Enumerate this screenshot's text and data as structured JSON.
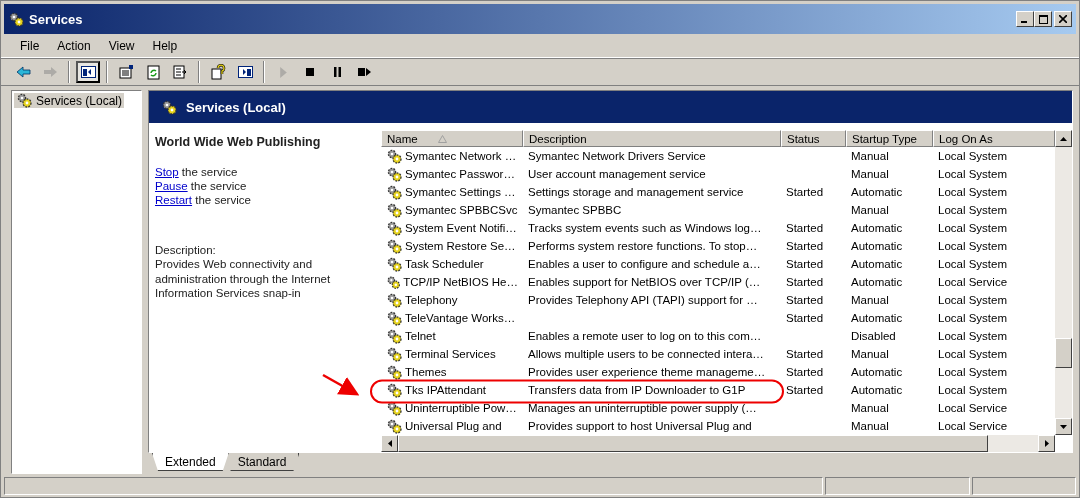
{
  "window": {
    "title": "Services"
  },
  "menu": [
    {
      "label": "File"
    },
    {
      "label": "Action"
    },
    {
      "label": "View"
    },
    {
      "label": "Help"
    }
  ],
  "toolbar": [
    {
      "kind": "back",
      "disabled": false,
      "pressed": false
    },
    {
      "kind": "forward",
      "disabled": true,
      "pressed": false
    },
    {
      "kind": "separator"
    },
    {
      "kind": "tree",
      "disabled": false,
      "pressed": true
    },
    {
      "kind": "separator"
    },
    {
      "kind": "properties",
      "disabled": false,
      "pressed": false
    },
    {
      "kind": "refresh",
      "disabled": false,
      "pressed": false
    },
    {
      "kind": "export",
      "disabled": false,
      "pressed": false
    },
    {
      "kind": "separator"
    },
    {
      "kind": "help",
      "disabled": false,
      "pressed": false
    },
    {
      "kind": "console",
      "disabled": false,
      "pressed": false
    },
    {
      "kind": "separator"
    },
    {
      "kind": "start",
      "disabled": true,
      "pressed": false
    },
    {
      "kind": "stop",
      "disabled": false,
      "pressed": false
    },
    {
      "kind": "pause",
      "disabled": false,
      "pressed": false
    },
    {
      "kind": "restart",
      "disabled": false,
      "pressed": false
    }
  ],
  "tree": [
    {
      "label": "Services (Local)",
      "selected": true
    }
  ],
  "header": {
    "title": "Services (Local)"
  },
  "details": {
    "title": "World Wide Web Publishing",
    "actions": [
      {
        "link": "Stop",
        "text": " the service"
      },
      {
        "link": "Pause",
        "text": " the service"
      },
      {
        "link": "Restart",
        "text": " the service"
      }
    ],
    "description_label": "Description:",
    "description": "Provides Web connectivity and administration through the Internet Information Services snap-in"
  },
  "table": {
    "columns": [
      {
        "label": "Name",
        "sorted": true
      },
      {
        "label": "Description",
        "sorted": false
      },
      {
        "label": "Status",
        "sorted": false
      },
      {
        "label": "Startup Type",
        "sorted": false
      },
      {
        "label": "Log On As",
        "sorted": false
      }
    ],
    "rows": [
      [
        "Symantec Network …",
        "Symantec Network Drivers Service",
        "",
        "Manual",
        "Local System"
      ],
      [
        "Symantec Passwor…",
        "User account management service",
        "",
        "Manual",
        "Local System"
      ],
      [
        "Symantec Settings …",
        "Settings storage and management service",
        "Started",
        "Automatic",
        "Local System"
      ],
      [
        "Symantec SPBBCSvc",
        "Symantec SPBBC",
        "",
        "Manual",
        "Local System"
      ],
      [
        "System Event Notifi…",
        "Tracks system events such as Windows log…",
        "Started",
        "Automatic",
        "Local System"
      ],
      [
        "System Restore Se…",
        "Performs system restore functions. To stop…",
        "Started",
        "Automatic",
        "Local System"
      ],
      [
        "Task Scheduler",
        "Enables a user to configure and schedule a…",
        "Started",
        "Automatic",
        "Local System"
      ],
      [
        "TCP/IP NetBIOS He…",
        "Enables support for NetBIOS over TCP/IP (…",
        "Started",
        "Automatic",
        "Local Service"
      ],
      [
        "Telephony",
        "Provides Telephony API (TAPI) support for …",
        "Started",
        "Manual",
        "Local System"
      ],
      [
        "TeleVantage Works…",
        "",
        "Started",
        "Automatic",
        "Local System"
      ],
      [
        "Telnet",
        "Enables a remote user to log on to this com…",
        "",
        "Disabled",
        "Local System"
      ],
      [
        "Terminal Services",
        "Allows multiple users to be connected intera…",
        "Started",
        "Manual",
        "Local System"
      ],
      [
        "Themes",
        "Provides user experience theme manageme…",
        "Started",
        "Automatic",
        "Local System"
      ],
      [
        "Tks IPAttendant",
        "Transfers data from IP Downloader to G1P",
        "Started",
        "Automatic",
        "Local System"
      ],
      [
        "Uninterruptible Pow…",
        "Manages an uninterruptible power supply (…",
        "",
        "Manual",
        "Local Service"
      ],
      [
        "Universal Plug and",
        "Provides support to host Universal Plug and",
        "",
        "Manual",
        "Local Service"
      ]
    ]
  },
  "tabs": [
    {
      "label": "Extended",
      "selected": true
    },
    {
      "label": "Standard",
      "selected": false
    }
  ]
}
